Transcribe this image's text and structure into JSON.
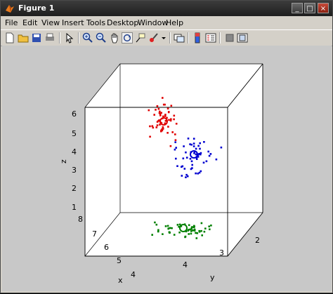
{
  "window": {
    "title": "Figure 1",
    "minimize": "_",
    "maximize": "□",
    "close": "×"
  },
  "menu": [
    "File",
    "Edit",
    "View",
    "Insert",
    "Tools",
    "Desktop",
    "Window",
    "Help"
  ],
  "toolbar_icons": [
    "new-figure-icon",
    "open-file-icon",
    "save-icon",
    "print-icon",
    "pointer-icon",
    "zoom-in-icon",
    "zoom-out-icon",
    "pan-icon",
    "rotate-3d-icon",
    "data-cursor-icon",
    "brush-icon",
    "link-plot-icon",
    "colorbar-icon",
    "legend-icon",
    "hide-plot-tools-icon",
    "show-plot-tools-icon"
  ],
  "plot": {
    "xlabel": "x",
    "ylabel": "y",
    "zlabel": "z",
    "z_ticks": [
      "6",
      "5",
      "4",
      "3",
      "2",
      "1"
    ],
    "x_ticks": [
      "8",
      "7",
      "6",
      "5",
      "4"
    ],
    "y_ticks": [
      "2",
      "3",
      "4"
    ],
    "colors": {
      "red": "#e00000",
      "blue": "#0000d0",
      "green": "#008000"
    }
  }
}
